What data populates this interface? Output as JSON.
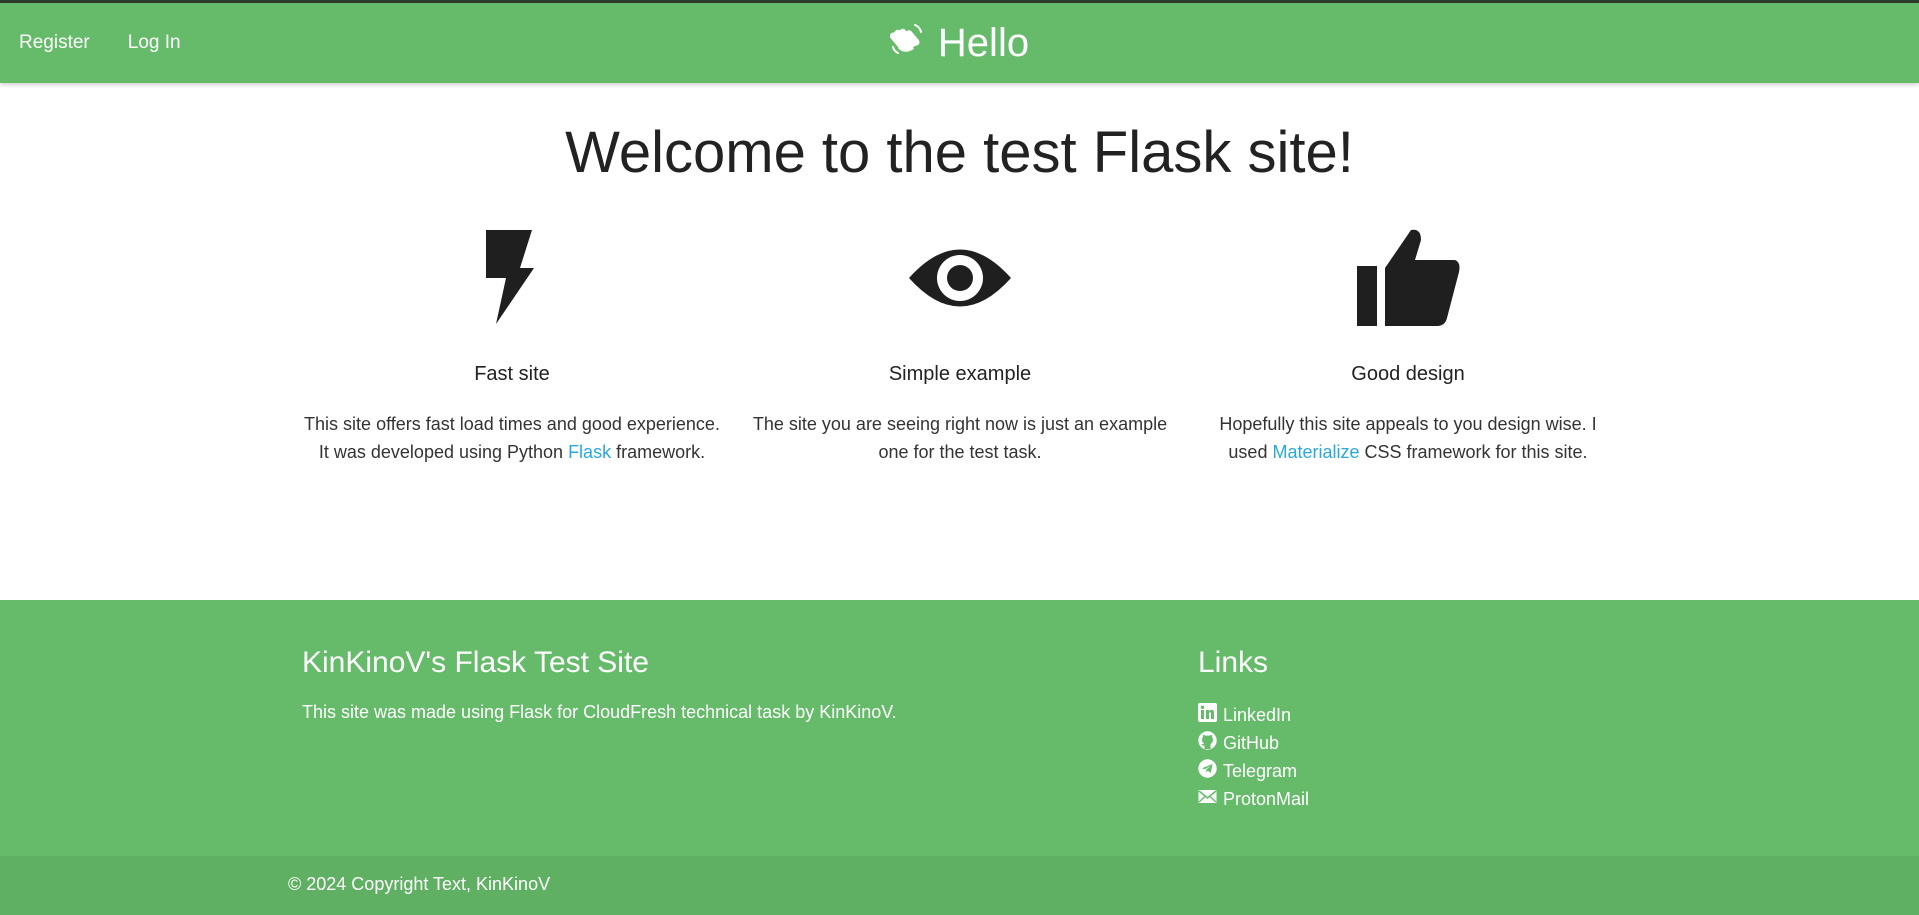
{
  "nav": {
    "links": [
      "Register",
      "Log In"
    ],
    "brand_icon": "waving-hand-icon",
    "brand_text": "Hello"
  },
  "main": {
    "heading": "Welcome to the test Flask site!",
    "features": [
      {
        "icon": "flash-icon",
        "title": "Fast site",
        "text_before": "This site offers fast load times and good experience. It was developed using Python ",
        "link_text": "Flask",
        "text_after": " framework."
      },
      {
        "icon": "eye-icon",
        "title": "Simple example",
        "text": "The site you are seeing right now is just an example one for the test task."
      },
      {
        "icon": "thumbs-up-icon",
        "title": "Good design",
        "text_before": "Hopefully this site appeals to you design wise. I used ",
        "link_text": "Materialize",
        "text_after": " CSS framework for this site."
      }
    ]
  },
  "footer": {
    "title": "KinKinoV's Flask Test Site",
    "text": "This site was made using Flask for CloudFresh technical task by KinKinoV.",
    "links_title": "Links",
    "links": [
      {
        "icon": "linkedin-icon",
        "label": "LinkedIn"
      },
      {
        "icon": "github-icon",
        "label": "GitHub"
      },
      {
        "icon": "telegram-icon",
        "label": "Telegram"
      },
      {
        "icon": "protonmail-icon",
        "label": "ProtonMail"
      }
    ],
    "copyright": "© 2024 Copyright Text, KinKinoV"
  },
  "colors": {
    "primary": "#66bb6a",
    "copyright_bar": "#5fb063",
    "link": "#29a8e0"
  }
}
